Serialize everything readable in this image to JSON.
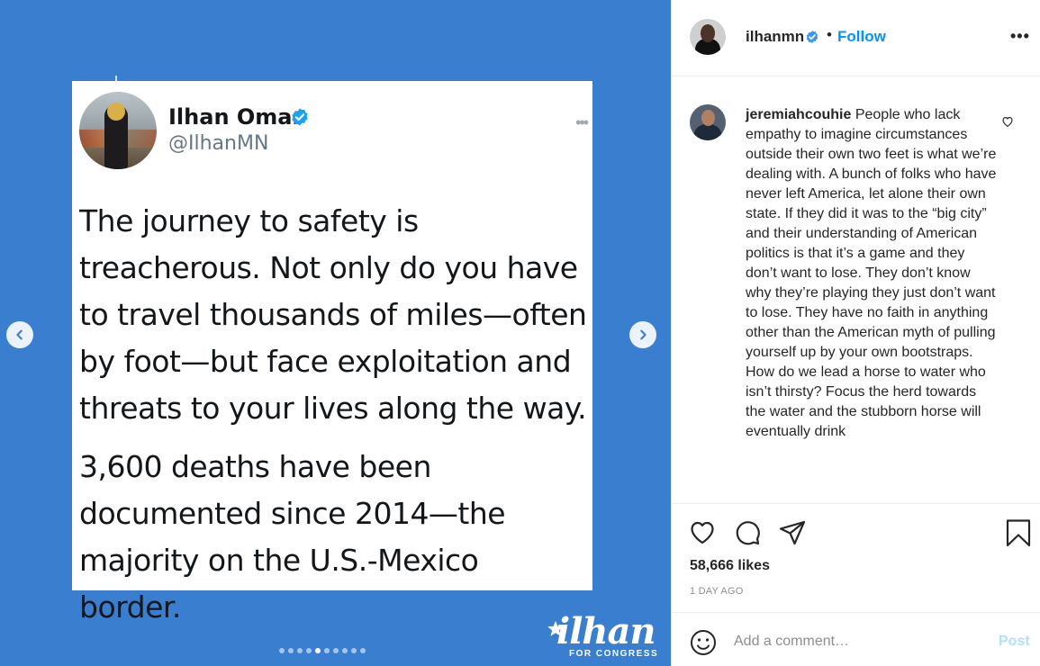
{
  "post": {
    "tweet": {
      "name": "Ilhan Omar",
      "handle": "@IlhanMN",
      "paragraphs": [
        "The journey to safety is treacherous. Not only do you have to travel thousands of miles—often by foot—but face exploitation and threats to your lives along the way.",
        "3,600 deaths have been documented since 2014—the majority on the U.S.-Mexico border."
      ]
    },
    "brand": {
      "name": "ilhan",
      "sub": "FOR CONGRESS"
    },
    "carousel": {
      "count": 10,
      "active_index": 4
    },
    "colors": {
      "background": "#3a7ed0",
      "accent": "#0095f6",
      "verified": "#1da1f2"
    }
  },
  "header": {
    "username": "ilhanmn",
    "separator": "•",
    "follow_label": "Follow",
    "more_label": "•••"
  },
  "comment": {
    "username": "jeremiahcouhie",
    "text": "People who lack empathy to imagine circumstances outside their own two feet is what we’re dealing with. A bunch of folks who have never left America, let alone their own state. If they did it was to the “big city” and their understanding of American politics is that it’s a game and they don’t want to lose. They don’t know why they’re playing they just don’t want to lose. They have no faith in anything other than the American myth of pulling yourself up by your own bootstraps. How do we lead a horse to water who isn’t thirsty? Focus the herd towards the water and the stubborn horse will eventually drink"
  },
  "stats": {
    "likes": "58,666 likes",
    "time": "1 DAY AGO"
  },
  "add_comment": {
    "placeholder": "Add a comment…",
    "post_label": "Post"
  }
}
